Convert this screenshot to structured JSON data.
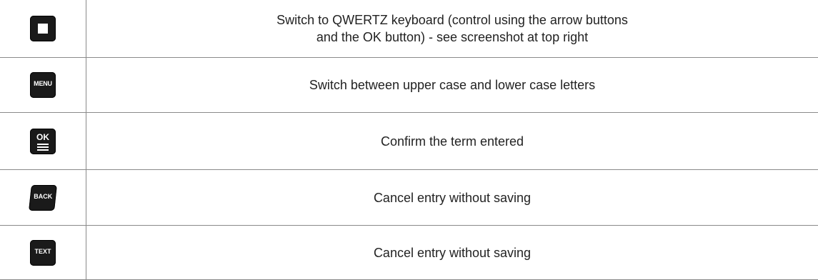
{
  "rows": [
    {
      "icon": "stop-square-key-icon",
      "key_label": "",
      "description_lines": [
        "Switch to QWERTZ keyboard (control using the arrow buttons",
        "and the OK button) - see screenshot at top right"
      ]
    },
    {
      "icon": "menu-key-icon",
      "key_label": "MENU",
      "description_lines": [
        "Switch between upper case and lower case letters"
      ]
    },
    {
      "icon": "ok-key-icon",
      "key_label": "OK",
      "description_lines": [
        "Confirm the term entered"
      ]
    },
    {
      "icon": "back-key-icon",
      "key_label": "BACK",
      "description_lines": [
        "Cancel entry without saving"
      ]
    },
    {
      "icon": "text-key-icon",
      "key_label": "TEXT",
      "description_lines": [
        "Cancel entry without saving"
      ]
    }
  ],
  "colors": {
    "key_fill": "#1a1a1a",
    "key_glyph": "#ffffff",
    "border": "#8a8a8a",
    "text": "#222222"
  }
}
